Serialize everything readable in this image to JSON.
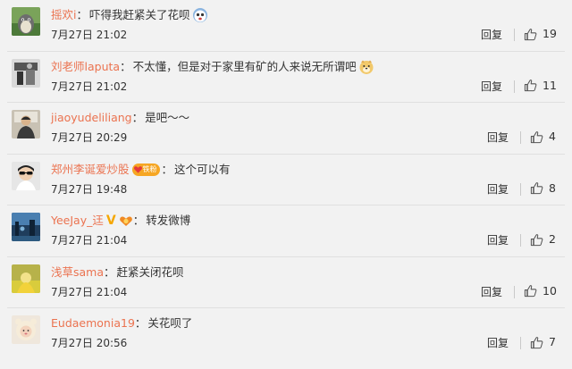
{
  "comments": [
    {
      "username": "摇欢i",
      "text": "吓得我赶紧关了花呗",
      "date": "7月27日",
      "time": "21:02",
      "reply_label": "回复",
      "like_count": "19",
      "emoji": "shocked-face",
      "avatar": "anime-avatar"
    },
    {
      "username": "刘老师laputa",
      "text": "不太懂，但是对于家里有矿的人来说无所谓吧",
      "date": "7月27日",
      "time": "21:02",
      "reply_label": "回复",
      "like_count": "11",
      "emoji": "doge-face",
      "avatar": "bw-photo-avatar"
    },
    {
      "username": "jiaoyudeliliang",
      "text": "是吧～～",
      "date": "7月27日",
      "time": "20:29",
      "reply_label": "回复",
      "like_count": "4",
      "avatar": "person-avatar"
    },
    {
      "username": "郑州李诞爱炒股",
      "fan_badge": "铁粉",
      "text": "这个可以有",
      "date": "7月27日",
      "time": "19:48",
      "reply_label": "回复",
      "like_count": "8",
      "avatar": "sunglasses-avatar"
    },
    {
      "username": "YeeJay_迋",
      "text": "转发微博",
      "date": "7月27日",
      "time": "21:04",
      "reply_label": "回复",
      "like_count": "2",
      "avatar": "landscape-avatar",
      "verified": "V"
    },
    {
      "username": "浅草sama",
      "text": "赶紧关闭花呗",
      "date": "7月27日",
      "time": "21:04",
      "reply_label": "回复",
      "like_count": "10",
      "avatar": "yellow-avatar"
    },
    {
      "username": "Eudaemonia19",
      "text": "关花呗了",
      "date": "7月27日",
      "time": "20:56",
      "reply_label": "回复",
      "like_count": "7",
      "avatar": "child-avatar"
    }
  ],
  "colors": {
    "username": "#eb7350",
    "text": "#333333",
    "background": "#f2f2f2",
    "badge": "#f6a623",
    "verified": "#f5a700"
  }
}
